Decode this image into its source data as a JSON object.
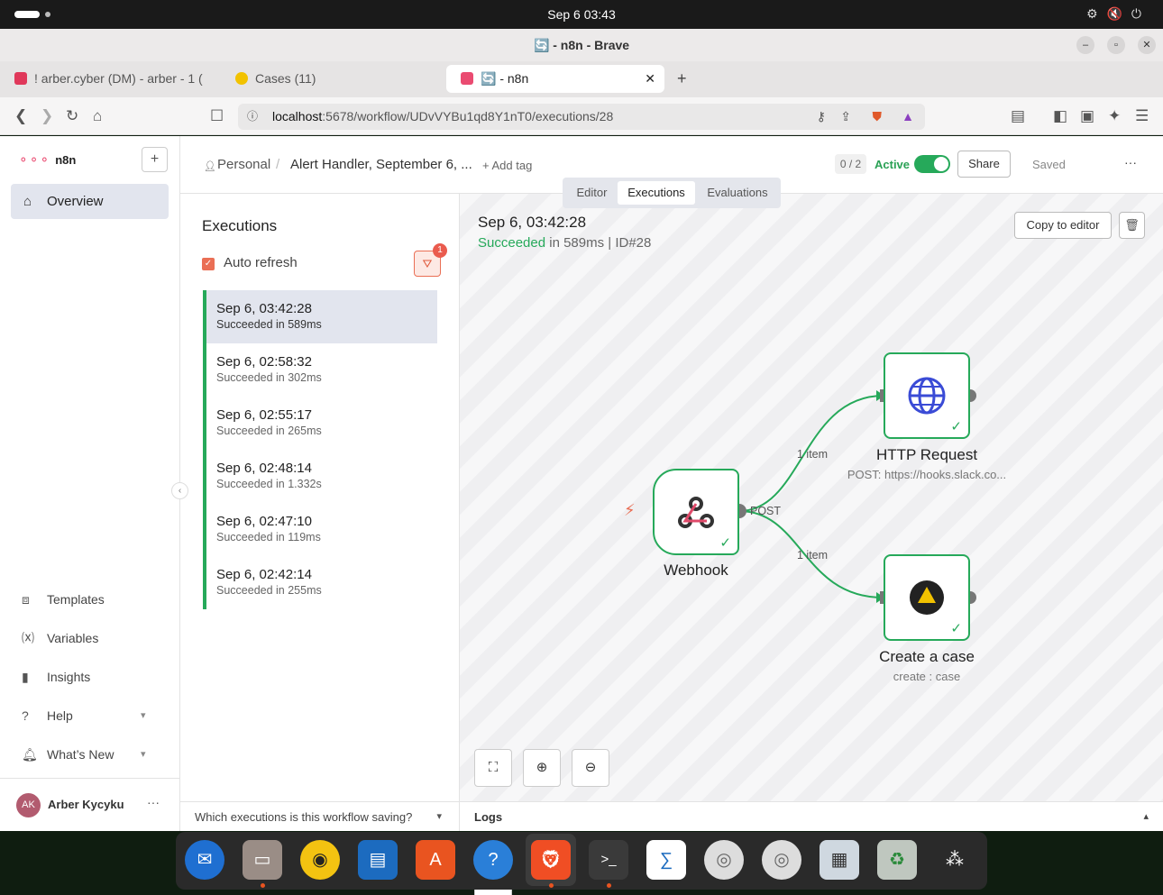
{
  "os": {
    "clock": "Sep 6  03:43"
  },
  "browser": {
    "title": "🔄 - n8n - Brave",
    "tabs": [
      {
        "label": "! arber.cyber (DM) - arber - 1 (",
        "color": "#e0385a"
      },
      {
        "label": "Cases (11)",
        "color": "#f2c200"
      },
      {
        "label": "🔄 - n8n",
        "color": "#ea4b71"
      }
    ],
    "url_host": "localhost",
    "url_path": ":5678/workflow/UDvVYBu1qd8Y1nT0/executions/28"
  },
  "sidebar": {
    "logo": "n8n",
    "overview": "Overview",
    "items": [
      {
        "label": "Templates",
        "icon": "box-icon"
      },
      {
        "label": "Variables",
        "icon": "variable-icon"
      },
      {
        "label": "Insights",
        "icon": "chart-icon"
      },
      {
        "label": "Help",
        "icon": "help-icon"
      },
      {
        "label": "What’s New",
        "icon": "bell-icon"
      }
    ],
    "user_initials": "AK",
    "user_name": "Arber Kycyku"
  },
  "header": {
    "project": "Personal",
    "workflow_name": "Alert Handler, September 6, ...",
    "add_tag": "+ Add tag",
    "counter": "0 / 2",
    "active_label": "Active",
    "share": "Share",
    "saved": "Saved",
    "tabs": [
      "Editor",
      "Executions",
      "Evaluations"
    ]
  },
  "executions": {
    "title": "Executions",
    "auto_refresh": "Auto refresh",
    "filter_badge": "1",
    "items": [
      {
        "time": "Sep 6, 03:42:28",
        "status": "Succeeded in 589ms"
      },
      {
        "time": "Sep 6, 02:58:32",
        "status": "Succeeded in 302ms"
      },
      {
        "time": "Sep 6, 02:55:17",
        "status": "Succeeded in 265ms"
      },
      {
        "time": "Sep 6, 02:48:14",
        "status": "Succeeded in 1.332s"
      },
      {
        "time": "Sep 6, 02:47:10",
        "status": "Succeeded in 119ms"
      },
      {
        "time": "Sep 6, 02:42:14",
        "status": "Succeeded in 255ms"
      }
    ],
    "saving_question": "Which executions is this workflow saving?"
  },
  "detail": {
    "time": "Sep 6, 03:42:28",
    "status_word": "Succeeded",
    "status_rest": " in 589ms | ID#28",
    "copy_to_editor": "Copy to editor",
    "nodes": {
      "webhook": {
        "label": "Webhook",
        "output": "POST"
      },
      "http": {
        "label": "HTTP Request",
        "sub": "POST: https://hooks.slack.co..."
      },
      "case": {
        "label": "Create a case",
        "sub": "create : case"
      }
    },
    "edge_labels": [
      "1 item",
      "1 item"
    ],
    "logs": "Logs"
  },
  "colors": {
    "success": "#26a95a",
    "accent": "#ea4b71",
    "warning": "#ea6f55"
  }
}
